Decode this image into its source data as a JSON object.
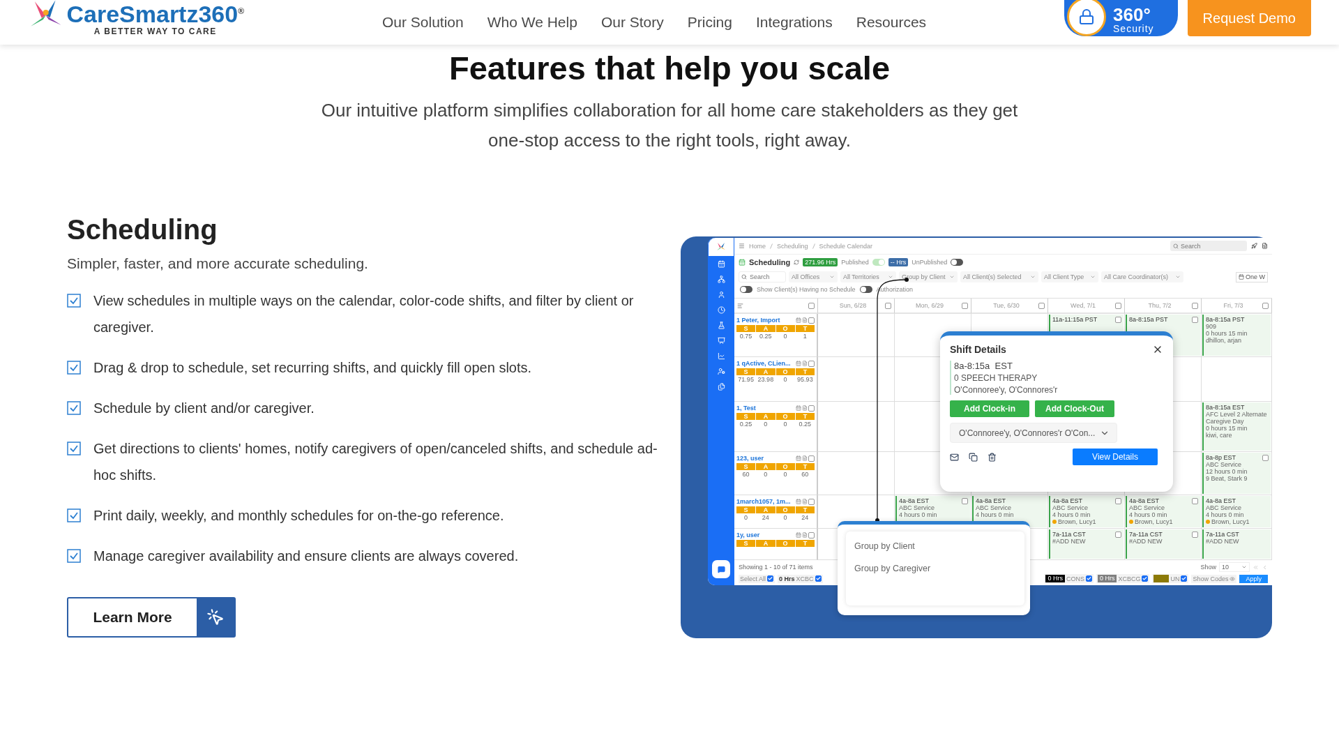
{
  "header": {
    "logo": {
      "name": "CareSmartz360",
      "mark": "®",
      "tagline": "A BETTER WAY TO CARE"
    },
    "nav": [
      "Our Solution",
      "Who We Help",
      "Our Story",
      "Pricing",
      "Integrations",
      "Resources"
    ],
    "security_badge": {
      "title": "360°",
      "subtitle": "Security"
    },
    "cta": "Request Demo"
  },
  "hero": {
    "title": "Features that help you scale",
    "subtitle": "Our intuitive platform simplifies collaboration for all home care stakeholders as they get one-stop access to the right tools, right away."
  },
  "feature": {
    "title": "Scheduling",
    "subtitle": "Simpler, faster, and more accurate scheduling.",
    "bullets": [
      "View schedules in multiple ways on the calendar, color-code shifts, and filter by client or caregiver.",
      "Drag & drop to schedule, set recurring shifts, and quickly fill open slots.",
      "Schedule by client and/or caregiver.",
      "Get directions to clients' homes, notify caregivers of open/canceled shifts, and schedule ad-hoc shifts.",
      "Print daily, weekly, and monthly schedules for on-the-go reference.",
      "Manage caregiver availability and ensure clients are always covered."
    ],
    "button": "Learn More"
  },
  "app": {
    "breadcrumb": [
      "Home",
      "Scheduling",
      "Schedule Calendar"
    ],
    "search_placeholder": "Search",
    "page_title": "Scheduling",
    "published": {
      "hours": "271.96 Hrs",
      "label": "Published",
      "on": true
    },
    "unpublished": {
      "hours": "-- Hrs",
      "label": "UnPublished",
      "on": false
    },
    "filters": [
      {
        "kind": "search",
        "placeholder": "Search"
      },
      {
        "kind": "select",
        "value": "All Offices"
      },
      {
        "kind": "select",
        "value": "All Territories"
      },
      {
        "kind": "select",
        "value": "Group by Client"
      },
      {
        "kind": "select",
        "value": "All Client(s) Selected"
      },
      {
        "kind": "select",
        "value": "All Client Type"
      },
      {
        "kind": "select",
        "value": "All Care Coordinator(s)"
      }
    ],
    "view_button": "One W",
    "toggles": [
      {
        "label": "Show Client(s) Having no Schedule",
        "on": false
      },
      {
        "label": "Authorization",
        "on": false
      }
    ],
    "header_checked": false,
    "days": [
      {
        "label": "Sun, 6/28",
        "checked": false
      },
      {
        "label": "Mon, 6/29",
        "checked": false
      },
      {
        "label": "Tue, 6/30",
        "checked": false
      },
      {
        "label": "Wed, 7/1",
        "checked": false
      },
      {
        "label": "Thu, 7/2",
        "checked": false
      },
      {
        "label": "Fri, 7/3",
        "checked": false
      }
    ],
    "clients": [
      {
        "name": "1 Peter, Import",
        "checked": false,
        "stats": [
          {
            "label": "S",
            "value": "0.75"
          },
          {
            "label": "A",
            "value": "0.25"
          },
          {
            "label": "O",
            "value": "0"
          },
          {
            "label": "T",
            "value": "1"
          }
        ],
        "cells": [
          null,
          null,
          null,
          {
            "time": "11a-11:15a PST",
            "checked": false
          },
          {
            "time": "8a-8:15a PST",
            "checked": false
          },
          {
            "time": "8a-8:15a PST",
            "service": "909",
            "duration": "0 hours 15 min",
            "caregiver": {
              "name": "dhillon, arjan"
            }
          }
        ]
      },
      {
        "name": "1 qActive, CLien...",
        "checked": false,
        "stats": [
          {
            "label": "S",
            "value": "71.95"
          },
          {
            "label": "A",
            "value": "23.98"
          },
          {
            "label": "O",
            "value": "0"
          },
          {
            "label": "T",
            "value": "95.93"
          }
        ],
        "cells": [
          null,
          null,
          null,
          null,
          null,
          null
        ]
      },
      {
        "name": "1, Test",
        "checked": false,
        "stats": [
          {
            "label": "S",
            "value": "0.25"
          },
          {
            "label": "A",
            "value": "0"
          },
          {
            "label": "O",
            "value": "0"
          },
          {
            "label": "T",
            "value": "0.25"
          }
        ],
        "cells": [
          null,
          null,
          null,
          null,
          null,
          {
            "time": "8a-8:15a EST",
            "service": "AFC Level 2 Alternate Caregive Day",
            "duration": "0 hours 15 min",
            "caregiver": {
              "name": "kiwi, care"
            }
          }
        ]
      },
      {
        "name": "123, user",
        "checked": false,
        "stats": [
          {
            "label": "S",
            "value": "60"
          },
          {
            "label": "A",
            "value": "0"
          },
          {
            "label": "O",
            "value": "0"
          },
          {
            "label": "T",
            "value": "60"
          }
        ],
        "cells": [
          null,
          null,
          null,
          null,
          null,
          {
            "time": "8a-8p EST",
            "service": "ABC Service",
            "duration": "12 hours 0 min",
            "caregiver": {
              "name": "9 Beat, Stark 9"
            },
            "checked": false
          }
        ]
      },
      {
        "name": "1march1057, 1m...",
        "checked": false,
        "stats": [
          {
            "label": "S",
            "value": "0"
          },
          {
            "label": "A",
            "value": "24"
          },
          {
            "label": "O",
            "value": "0"
          },
          {
            "label": "T",
            "value": "24"
          }
        ],
        "cells": [
          null,
          {
            "time": "4a-8a EST",
            "service": "ABC Service",
            "duration": "4 hours 0 min",
            "checked": false
          },
          {
            "time": "4a-8a EST",
            "service": "ABC Service",
            "duration": "4 hours 0 min"
          },
          {
            "time": "4a-8a EST",
            "service": "ABC Service",
            "duration": "4 hours 0 min",
            "caregiver": {
              "name": "Brown, Lucy1",
              "color": "#f0a500"
            },
            "checked": false
          },
          {
            "time": "4a-8a EST",
            "service": "ABC Service",
            "duration": "4 hours 0 min",
            "caregiver": {
              "name": "Brown, Lucy1",
              "color": "#f0a500"
            },
            "checked": false
          },
          {
            "time": "4a-8a EST",
            "service": "ABC Service",
            "duration": "4 hours 0 min",
            "caregiver": {
              "name": "Brown, Lucy1",
              "color": "#f0a500"
            }
          }
        ]
      },
      {
        "name": "1y, user",
        "checked": false,
        "stats": [
          {
            "label": "S"
          },
          {
            "label": "A"
          },
          {
            "label": "O"
          },
          {
            "label": "T"
          }
        ],
        "cells": [
          null,
          null,
          null,
          {
            "time": "7a-11a CST",
            "service": "#ADD NEW",
            "checked": false
          },
          {
            "time": "7a-11a CST",
            "service": "#ADD NEW",
            "checked": false
          },
          {
            "time": "7a-11a CST",
            "service": "#ADD NEW"
          }
        ]
      }
    ],
    "showing": "Showing 1 - 10 of 71 items",
    "page_size_label": "Show",
    "page_size": "10",
    "legend_left": [
      {
        "kind": "plain",
        "label": "Select All",
        "checked": true
      },
      {
        "kind": "code",
        "hours": "0 Hrs",
        "label": "XCBC",
        "checked": true
      }
    ],
    "legend_right": [
      {
        "kind": "code",
        "hours": "0 Hrs",
        "color": "#000000",
        "label": "CONS",
        "checked": true
      },
      {
        "kind": "code",
        "hours": "0 Hrs",
        "color": "#808080",
        "label": "XCBCG",
        "checked": true
      },
      {
        "kind": "swatch",
        "color": "#8c7a08",
        "label": "UN",
        "checked": true
      }
    ],
    "show_codes": "Show Codes",
    "apply": "Apply",
    "shift_details": {
      "title": "Shift Details",
      "time": "8a-8:15a  EST",
      "service": "0 SPEECH THERAPY",
      "client": "O'Connoree'y, O'Connores'r",
      "actions": [
        "Add Clock-in",
        "Add Clock-Out"
      ],
      "caregiver_select": "O'Connoree'y, O'Connores'r O'Con...",
      "button": "View Details"
    },
    "group_menu": {
      "options": [
        "Group by Client",
        "Group by Caregiver"
      ]
    }
  }
}
